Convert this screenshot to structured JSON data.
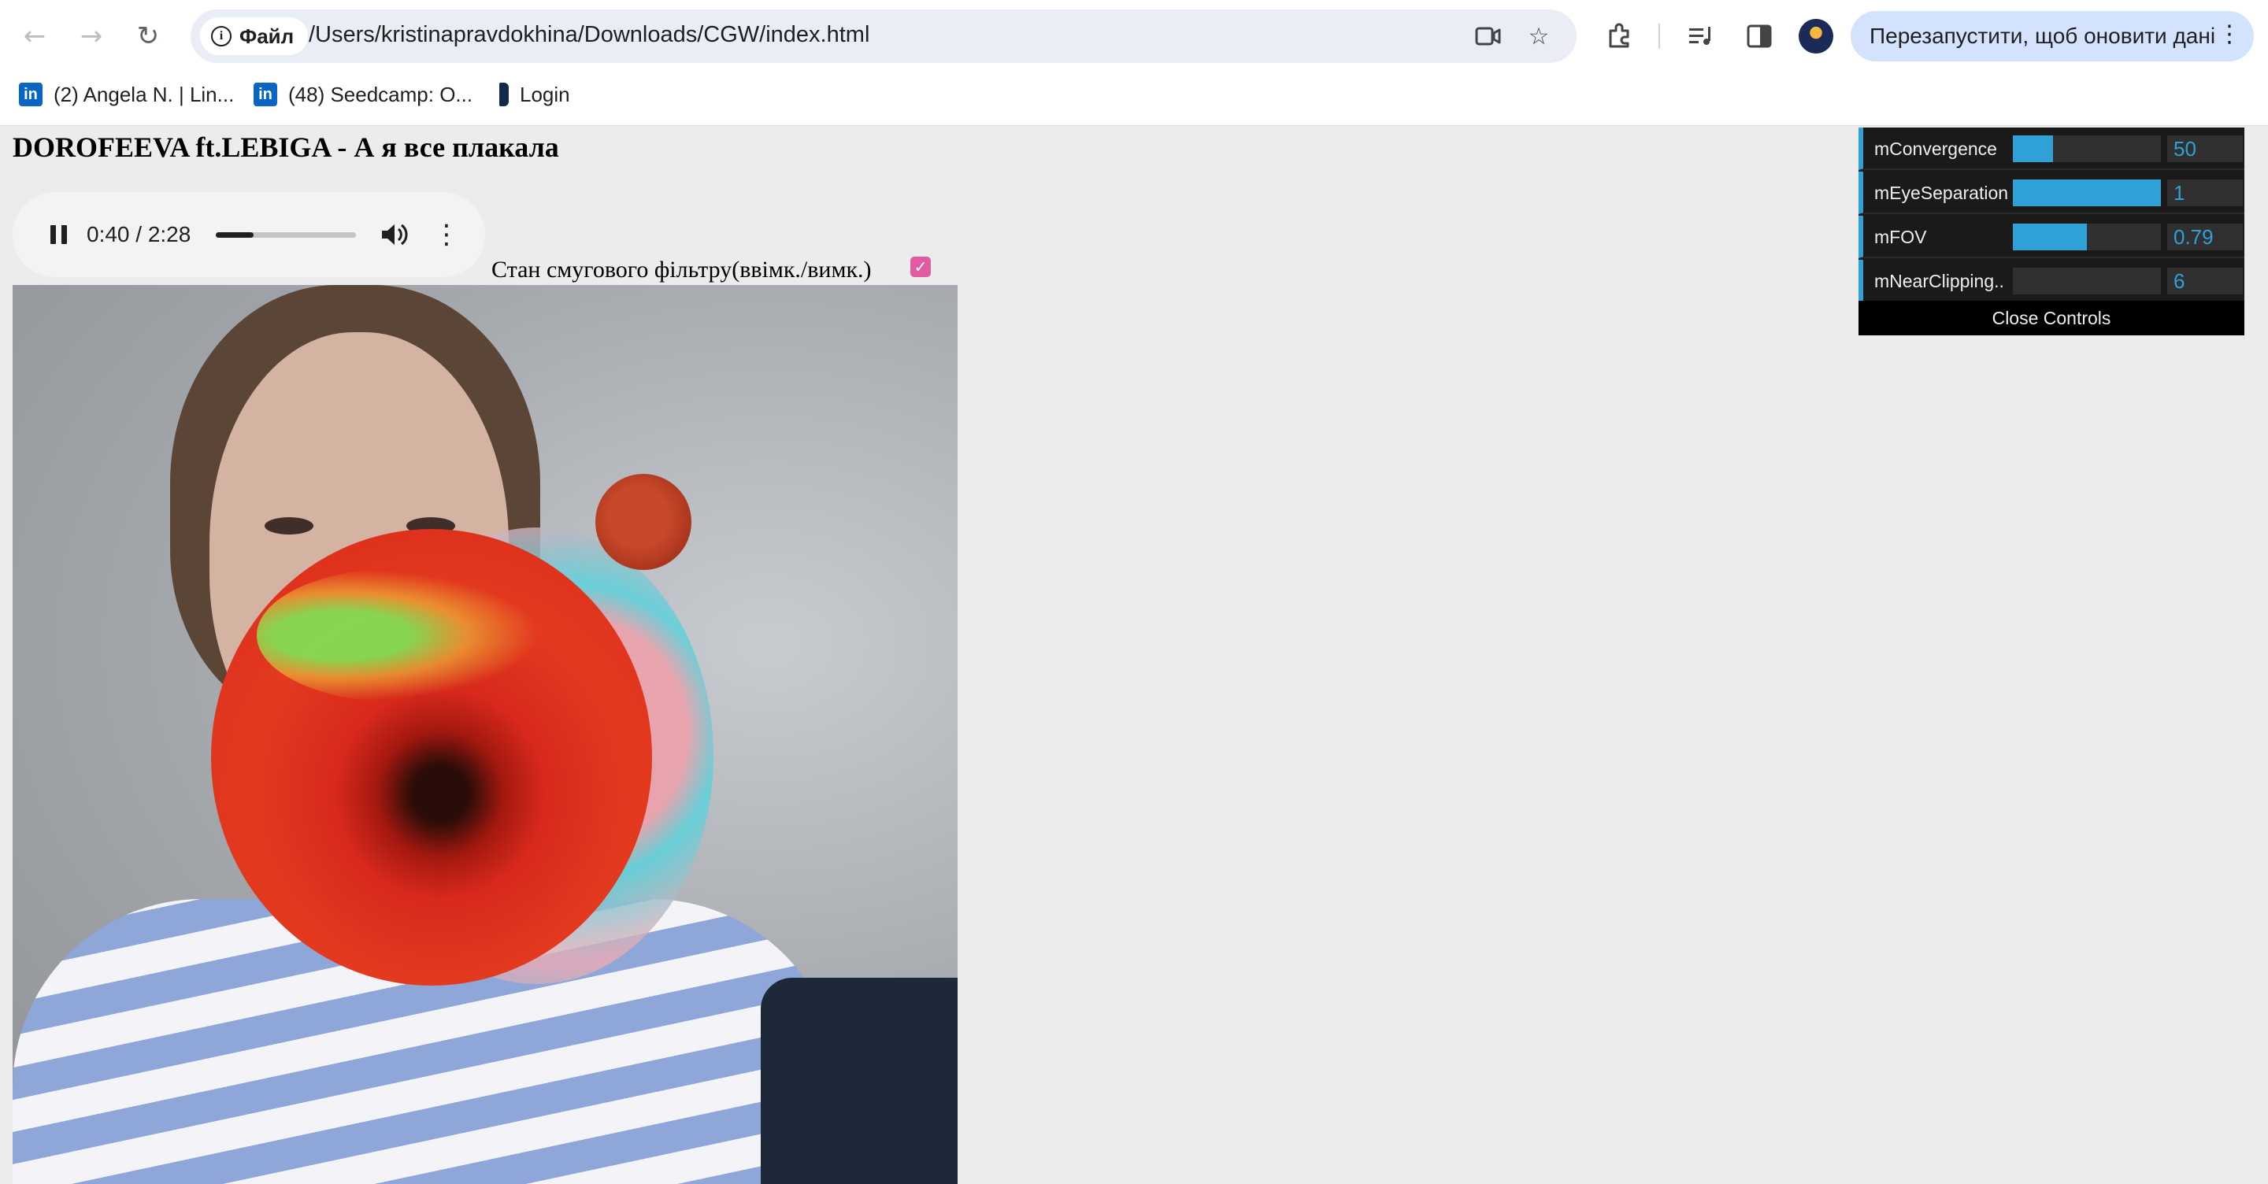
{
  "browser": {
    "site_chip_label": "Файл",
    "url": "/Users/kristinapravdokhina/Downloads/CGW/index.html",
    "relaunch_label": "Перезапустити, щоб оновити дані",
    "nav_icons": [
      "back-arrow-icon",
      "forward-arrow-icon",
      "reload-icon"
    ],
    "omnibox_icons": [
      "camera-icon",
      "star-icon"
    ],
    "toolbar_icons": [
      "puzzle-icon",
      "media-controls-icon",
      "side-panel-icon",
      "avatar"
    ]
  },
  "bookmarks": [
    {
      "label": "(2) Angela N. | Lin...",
      "icon": "linkedin-icon"
    },
    {
      "label": "(48) Seedcamp: O...",
      "icon": "linkedin-icon"
    },
    {
      "label": "Login",
      "icon": "bookmark-icon"
    }
  ],
  "page": {
    "title": "DOROFEEVA ft.LEBIGA - А я все плакала",
    "audio": {
      "time": "0:40 / 2:28",
      "progress": 0.27,
      "icons": [
        "pause-icon",
        "volume-icon",
        "more-vert-icon"
      ]
    },
    "filter": {
      "label": "Стан смугового фільтру(ввімк./вимк.)",
      "checked": true,
      "accent_color": "#e15ba0"
    }
  },
  "gui": {
    "accent_color": "#2fa1d6",
    "controls": [
      {
        "label": "mConvergence",
        "value": "50",
        "fill": 0.27
      },
      {
        "label": "mEyeSeparation",
        "value": "1",
        "fill": 1.0
      },
      {
        "label": "mFOV",
        "value": "0.79",
        "fill": 0.5
      },
      {
        "label": "mNearClipping..",
        "value": "6",
        "fill": 0.0
      }
    ],
    "close_label": "Close Controls"
  }
}
